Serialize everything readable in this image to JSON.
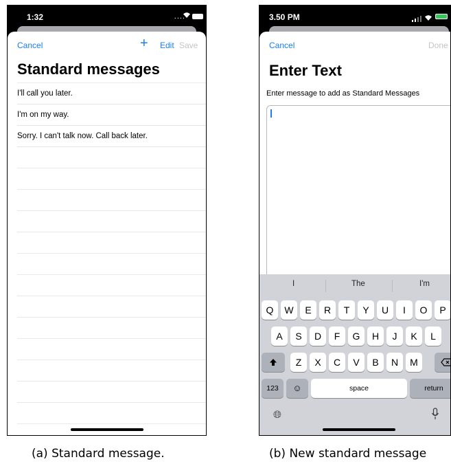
{
  "panel_a": {
    "status_time": "1:32",
    "nav": {
      "cancel": "Cancel",
      "add": "+",
      "edit": "Edit",
      "save": "Save"
    },
    "title": "Standard messages",
    "messages": [
      "I'll call you later.",
      "I'm on my way.",
      "Sorry. I can't talk now. Call back later."
    ],
    "caption": "(a) Standard message."
  },
  "panel_b": {
    "status_time": "3.50 PM",
    "nav": {
      "cancel": "Cancel",
      "done": "Done"
    },
    "title": "Enter Text",
    "subtitle": "Enter message to add as Standard Messages",
    "suggestions": [
      "I",
      "The",
      "I'm"
    ],
    "keyboard": {
      "row1": [
        "Q",
        "W",
        "E",
        "R",
        "T",
        "Y",
        "U",
        "I",
        "O",
        "P"
      ],
      "row2": [
        "A",
        "S",
        "D",
        "F",
        "G",
        "H",
        "J",
        "K",
        "L"
      ],
      "row3": [
        "Z",
        "X",
        "C",
        "V",
        "B",
        "N",
        "M"
      ],
      "numbers_key": "123",
      "space_key": "space",
      "return_key": "return"
    },
    "caption": "(b) New standard message"
  },
  "colors": {
    "accent": "#1a7df2",
    "disabled": "#c4c4c6",
    "keyboard_bg": "#d1d3d9"
  }
}
